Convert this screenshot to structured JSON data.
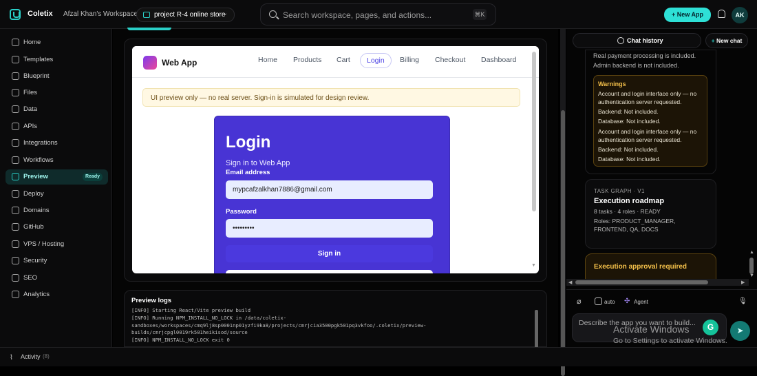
{
  "topbar": {
    "app_name": "Coletix",
    "workspace": "Afzal Khan's Workspace",
    "project": "project R-4 online store",
    "search_placeholder": "Search workspace, pages, and actions...",
    "search_shortcut": "⌘K",
    "new_app_label": "+ New App",
    "avatar_initials": "AK",
    "accent_color": "#2ee0d6"
  },
  "sidebar": {
    "items": [
      {
        "label": "Home",
        "icon": "home-icon"
      },
      {
        "label": "Templates",
        "icon": "templates-icon"
      },
      {
        "label": "Blueprint",
        "icon": "blueprint-icon"
      },
      {
        "label": "Files",
        "icon": "file-icon"
      },
      {
        "label": "Data",
        "icon": "database-icon"
      },
      {
        "label": "APIs",
        "icon": "api-icon"
      },
      {
        "label": "Integrations",
        "icon": "plug-icon"
      },
      {
        "label": "Workflows",
        "icon": "workflow-icon"
      },
      {
        "label": "Preview",
        "icon": "preview-icon",
        "badge": "Ready",
        "active": true
      },
      {
        "label": "Deploy",
        "icon": "rocket-icon"
      },
      {
        "label": "Domains",
        "icon": "globe-icon"
      },
      {
        "label": "GitHub",
        "icon": "github-icon"
      },
      {
        "label": "VPS / Hosting",
        "icon": "server-icon"
      },
      {
        "label": "Security",
        "icon": "shield-icon"
      },
      {
        "label": "SEO",
        "icon": "seo-icon"
      },
      {
        "label": "Analytics",
        "icon": "analytics-icon"
      }
    ]
  },
  "activity": {
    "label": "Activity",
    "count": "(8)"
  },
  "preview": {
    "site_name": "Web App",
    "nav": [
      "Home",
      "Products",
      "Cart",
      "Login",
      "Billing",
      "Checkout",
      "Dashboard"
    ],
    "active_nav": "Login",
    "notice": "UI preview only — no real server. Sign-in is simulated for design review.",
    "login": {
      "title": "Login",
      "subtitle": "Sign in to Web App",
      "email_label": "Email address",
      "email_value": "mypcafzalkhan7886@gmail.com",
      "password_label": "Password",
      "password_value": "•••••••••",
      "submit_label": "Sign in"
    }
  },
  "logs": {
    "title": "Preview logs",
    "lines": "[INFO] Starting React/Vite preview build\n[INFO] Running NPM_INSTALL_NO_LOCK in /data/coletix-sandboxes/workspaces/cmq9lj8sp0001np01yzfi9ka8/projects/cmrjcia3500pgk501pq3vkfoo/.coletix/preview-builds/cmrjcpgl0019rk501heikisod/source\n[INFO] NPM_INSTALL_NO_LOCK exit 0"
  },
  "chat": {
    "history_label": "Chat history",
    "new_chat_label": "New chat",
    "summary_lines": [
      "Real payment processing is included.",
      "Admin backend is not included."
    ],
    "warnings_title": "Warnings",
    "warnings": [
      "Account and login interface only — no authentication server requested.",
      "Backend: Not included.",
      "Database: Not included.",
      "Account and login interface only — no authentication server requested.",
      "Backend: Not included.",
      "Database: Not included."
    ],
    "task_graph": {
      "kicker": "TASK GRAPH · V1",
      "title": "Execution roadmap",
      "meta": "8 tasks · 4 roles · READY",
      "roles": "Roles: PRODUCT_MANAGER, FRONTEND, QA, DOCS"
    },
    "approval_title": "Execution approval required",
    "tools": {
      "auto_label": "auto",
      "agent_label": "Agent"
    },
    "composer_placeholder": "Describe the app you want to build...",
    "warning_color": "#f4c04a"
  },
  "watermark": {
    "line1": "Activate Windows",
    "line2": "Go to Settings to activate Windows."
  }
}
